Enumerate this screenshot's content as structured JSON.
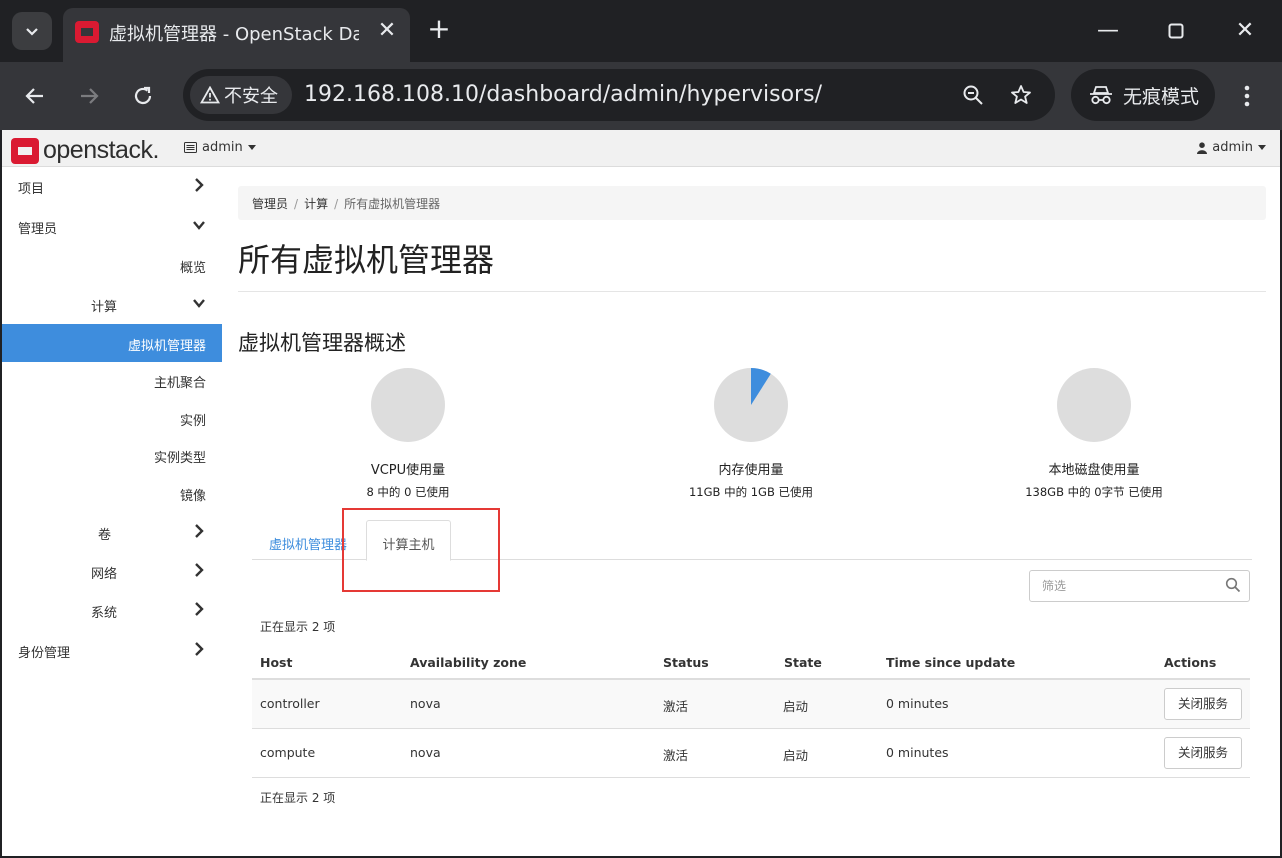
{
  "browser": {
    "tab_title": "虚拟机管理器 - OpenStack Dashboard",
    "security_label": "不安全",
    "url": "192.168.108.10/dashboard/admin/hypervisors/",
    "incognito_label": "无痕模式"
  },
  "header": {
    "logo_text": "openstack.",
    "project": "admin",
    "user": "admin"
  },
  "sidebar": {
    "items": [
      {
        "label": "项目"
      },
      {
        "label": "管理员"
      },
      {
        "label": "概览"
      },
      {
        "label": "计算"
      },
      {
        "label": "虚拟机管理器"
      },
      {
        "label": "主机聚合"
      },
      {
        "label": "实例"
      },
      {
        "label": "实例类型"
      },
      {
        "label": "镜像"
      },
      {
        "label": "卷"
      },
      {
        "label": "网络"
      },
      {
        "label": "系统"
      },
      {
        "label": "身份管理"
      }
    ]
  },
  "breadcrumb": [
    "管理员",
    "计算",
    "所有虚拟机管理器"
  ],
  "page_title": "所有虚拟机管理器",
  "summary": {
    "title": "虚拟机管理器概述",
    "charts": [
      {
        "name": "VCPU使用量",
        "sub": "8 中的 0 已使用",
        "fraction": 0.0
      },
      {
        "name": "内存使用量",
        "sub": "11GB 中的 1GB 已使用",
        "fraction": 0.09
      },
      {
        "name": "本地磁盘使用量",
        "sub": "138GB 中的 0字节 已使用",
        "fraction": 0.0
      }
    ]
  },
  "tabs": [
    "虚拟机管理器",
    "计算主机"
  ],
  "filter": {
    "placeholder": "筛选"
  },
  "table": {
    "count_text": "正在显示 2 项",
    "columns": [
      "Host",
      "Availability zone",
      "Status",
      "State",
      "Time since update",
      "Actions"
    ],
    "rows": [
      {
        "host": "controller",
        "zone": "nova",
        "status": "激活",
        "state": "启动",
        "updated": "0 minutes",
        "action": "关闭服务"
      },
      {
        "host": "compute",
        "zone": "nova",
        "status": "激活",
        "state": "启动",
        "updated": "0 minutes",
        "action": "关闭服务"
      }
    ]
  },
  "colors": {
    "accent": "#3e8ddd",
    "pie_empty": "#dddddd",
    "highlight": "#e53935",
    "brand": "#da1a32"
  }
}
